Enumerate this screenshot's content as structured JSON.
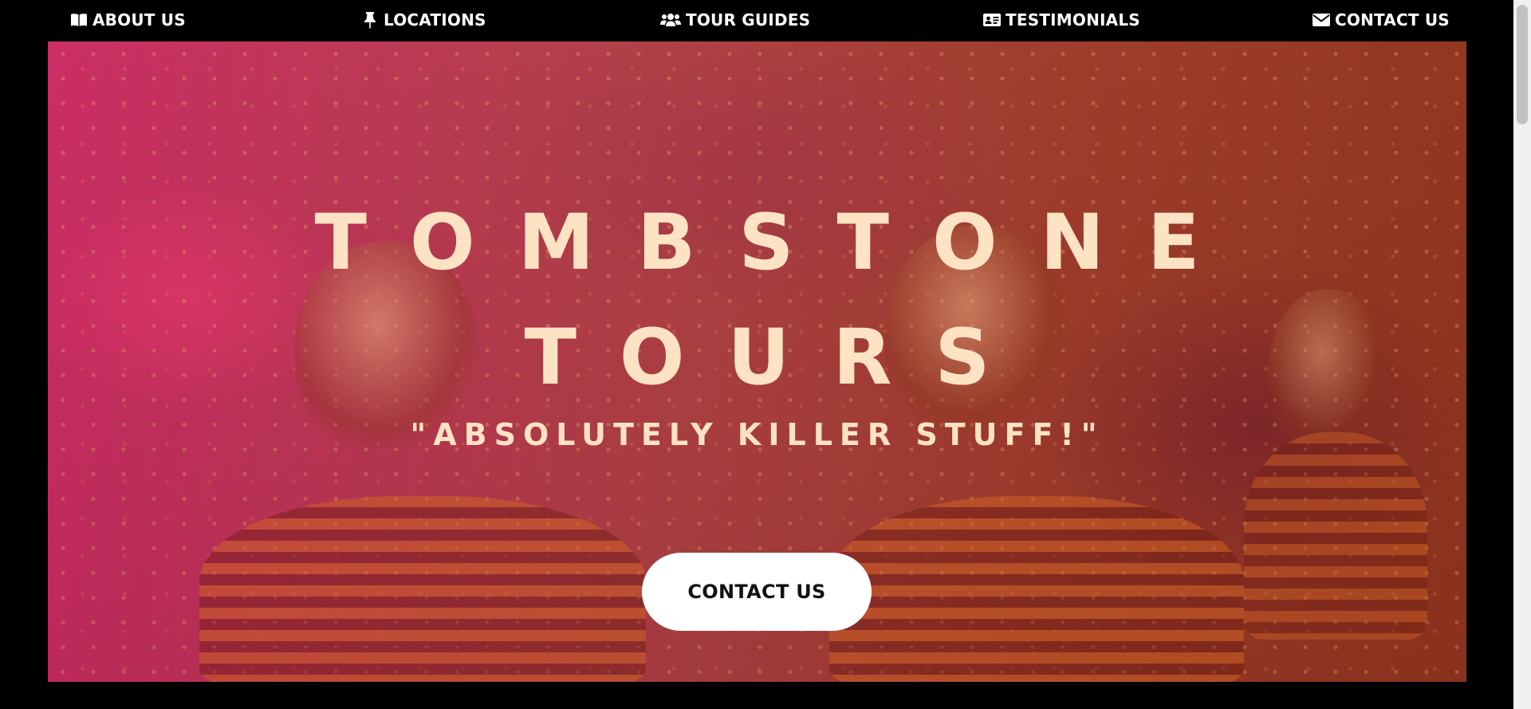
{
  "nav": {
    "items": [
      {
        "label": "ABOUT US",
        "icon": "book-open-icon"
      },
      {
        "label": "LOCATIONS",
        "icon": "thumbtack-icon"
      },
      {
        "label": "TOUR GUIDES",
        "icon": "users-icon"
      },
      {
        "label": "TESTIMONIALS",
        "icon": "id-card-icon"
      },
      {
        "label": "CONTACT US",
        "icon": "envelope-icon"
      }
    ]
  },
  "hero": {
    "title_line1": "TOMBSTONE",
    "title_line2": "TOURS",
    "tagline": "\"ABSOLUTELY KILLER STUFF!\"",
    "cta_label": "CONTACT US",
    "text_color": "#fde3c4"
  },
  "colors": {
    "background": "#000000",
    "nav_text": "#ffffff",
    "cta_background": "#ffffff",
    "cta_text": "#111111"
  }
}
